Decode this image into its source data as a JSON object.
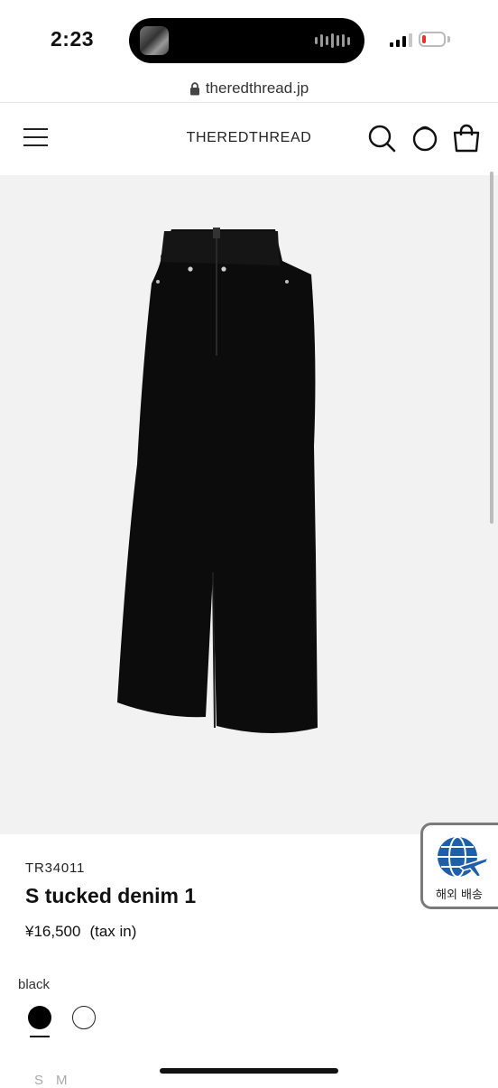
{
  "status_bar": {
    "time": "2:23"
  },
  "browser": {
    "url": "theredthread.jp"
  },
  "header": {
    "logo": "THEREDTHREAD",
    "menu_icon": "hamburger-menu-icon",
    "search_icon": "search-icon",
    "account_icon": "account-circle-icon",
    "cart_icon": "shopping-bag-icon"
  },
  "product": {
    "sku": "TR34011",
    "name": "S tucked denim 1",
    "price": "¥16,500",
    "tax_note": "(tax in)",
    "color_label": "black",
    "colors": [
      {
        "name": "black",
        "hex": "#000000",
        "selected": true
      },
      {
        "name": "white",
        "hex": "#ffffff",
        "selected": false
      }
    ],
    "sizes": [
      "S",
      "M"
    ]
  },
  "shipping_badge": {
    "label": "해외 배송",
    "icon": "globe-airplane-icon"
  },
  "colors": {
    "image_background": "#f2f2f2",
    "badge_blue": "#1f5fa8",
    "accent_black": "#111111"
  }
}
